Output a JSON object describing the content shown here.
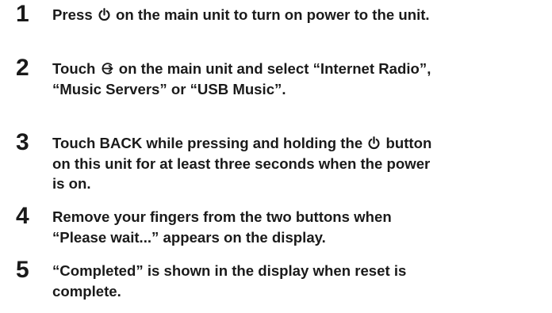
{
  "steps": [
    {
      "number": "1",
      "text_a": "Press",
      "icon": "power-icon",
      "text_b": "on the main unit to turn on power to the unit."
    },
    {
      "number": "2",
      "text_a": "Touch",
      "icon": "input-source-icon",
      "text_b": "on the main unit and select “Internet Radio”,",
      "text_c": "“Music Servers” or “USB Music”."
    },
    {
      "number": "3",
      "text_a": "Touch BACK while pressing and holding the",
      "icon": "power-icon",
      "text_b": "button",
      "text_c": "on this unit for at least three seconds when the power",
      "text_d": "is on."
    },
    {
      "number": "4",
      "text_a": "Remove your fingers from the two buttons when",
      "text_b": "“Please wait...” appears on the display."
    },
    {
      "number": "5",
      "text_a": "“Completed” is shown in the display when reset is",
      "text_b": "complete."
    }
  ]
}
